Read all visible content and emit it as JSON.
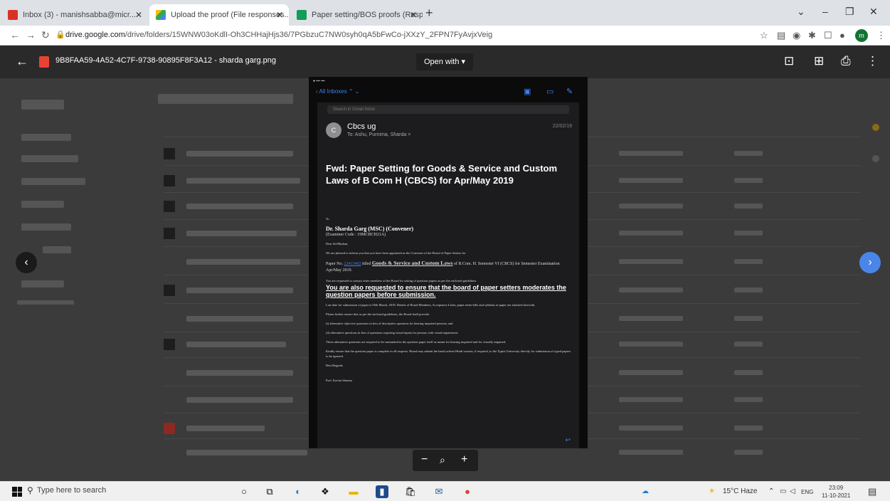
{
  "browser": {
    "tabs": [
      {
        "label": "Inbox (3) - manishsabba@micr..."
      },
      {
        "label": "Upload the proof (File responses..."
      },
      {
        "label": "Paper setting/BOS proofs (Respo..."
      }
    ],
    "url_prefix": "drive.google.com",
    "url_rest": "/drive/folders/15WNW03oKdlI-Oh3CHHajHjs36/7PGbzuC7NW0syh0qA5bFwCo-jXXzY_2FPN7FyAvjxVeig",
    "avatar_initial": "m"
  },
  "viewer": {
    "filename": "9B8FAA59-4A52-4C7F-9738-90895F8F3A12 - sharda garg.png",
    "open_with": "Open with ▾"
  },
  "email": {
    "back_label": "All Inboxes",
    "search_placeholder": "Search in Gmail Inbox",
    "sender": "Cbcs ug",
    "recipients": "To: Ashu, Purnima, Sharda >",
    "date": "22/02/19",
    "subject": "Fwd: Paper Setting for Goods & Service and Custom Laws of B Com H (CBCS) for Apr/May 2019",
    "to_label": "To",
    "teacher_name": "Dr. Sharda Garg (MSC) (Convener)",
    "teacher_code": "(Examiner Code : 19MCBCH21A)",
    "greeting": "Dear Sir/Madam,",
    "p1": "We are pleased to inform you that you have been appointed as the Convener of the Board of Paper Setters for",
    "paper_no_label": "Paper No.",
    "paper_no": "22415402",
    "paper_title_label": "titled",
    "paper_title": "Goods & Service and Custom Laws",
    "p1_tail": "of B.Com. H. Semester VI (CBCS) for Semester Examination Apr/May 2019.",
    "p2": "You are requested to contact other members of the Board for setting of question papers as per the enclosed guidelines.",
    "p2_emph": "You are also requested to ensure that the board of paper setters moderates the question papers before submission.",
    "p3": "Last date for submission of paper is 05th March, 2019. Details of Board Members, Acceptance Letter, paper setter bills and syllabus of paper are attached herewith.",
    "p4": "Please further ensure that as per the enclosed guidelines, the Board shall provide:",
    "p5": "(i) alternative objective questions in lieu of descriptive questions for hearing impaired persons; and",
    "p6": "(ii) alternative questions in lieu of questions requiring visual inputs for persons with visual impairment.",
    "p7": "These alternative questions are required to be earmarked in the question paper itself as meant for hearing impaired and for visually impaired.",
    "p8": "Kindly ensure that the question paper is complete in all respects. Board may submit the hand written Hindi version, if required, to the Typist University directly for submission of typed papers to be ignored.",
    "regards": "Best Regards",
    "signoff": "Prof. Kavita Sharma"
  },
  "taskbar": {
    "search_placeholder": "Type here to search",
    "weather": "15°C Haze",
    "lang": "ENG",
    "time": "23:09",
    "date": "11-10-2021"
  }
}
